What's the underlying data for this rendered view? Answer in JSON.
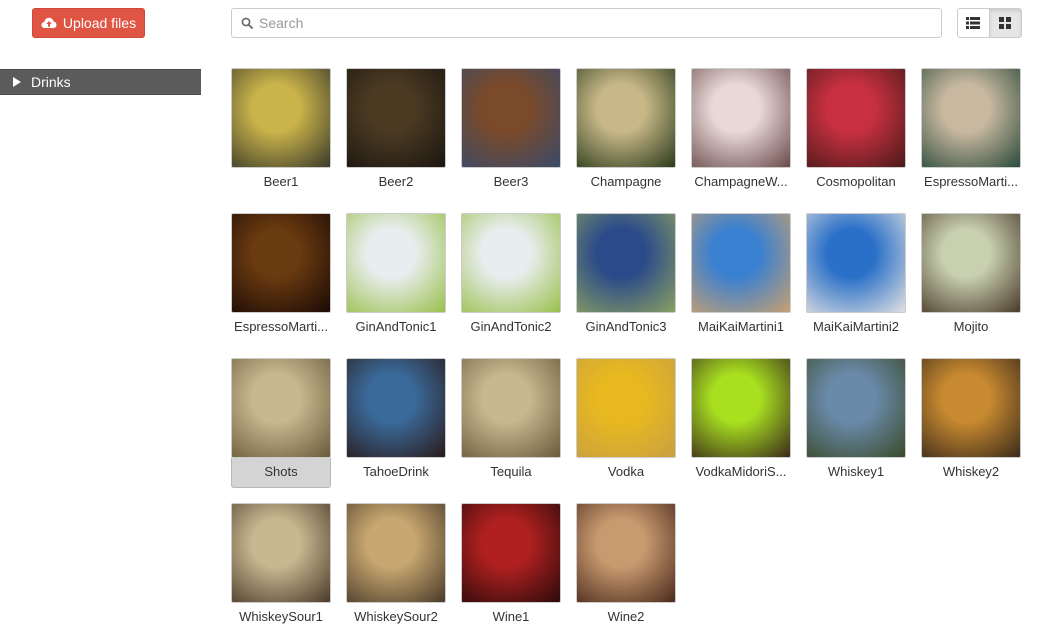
{
  "toolbar": {
    "upload_label": "Upload files",
    "search_placeholder": "Search",
    "search_value": "",
    "view_list_icon": "list-icon",
    "view_grid_icon": "grid-icon",
    "active_view": "grid"
  },
  "sidebar": {
    "items": [
      {
        "label": "Drinks",
        "icon": "triangle-right-icon",
        "expanded": false
      }
    ]
  },
  "colors": {
    "upload_bg": "#e05444",
    "sidebar_bg": "#5b5b5b",
    "selected_bg": "#d4d4d4"
  },
  "files": [
    {
      "label": "Beer1",
      "colors": [
        "#c9b34a",
        "#3a3a2a"
      ]
    },
    {
      "label": "Beer2",
      "colors": [
        "#4a3a22",
        "#1b1510"
      ]
    },
    {
      "label": "Beer3",
      "colors": [
        "#7a4a2a",
        "#3a4a6a"
      ]
    },
    {
      "label": "Champagne",
      "colors": [
        "#c8b888",
        "#2a3a1a"
      ]
    },
    {
      "label": "ChampagneW...",
      "colors": [
        "#e8d8d8",
        "#6a4a4a"
      ]
    },
    {
      "label": "Cosmopolitan",
      "colors": [
        "#c83040",
        "#4a1a1a"
      ]
    },
    {
      "label": "EspressoMarti...",
      "colors": [
        "#c8b8a0",
        "#2a4a3a"
      ]
    },
    {
      "label": "EspressoMarti...",
      "colors": [
        "#6a3a10",
        "#1a0a05"
      ]
    },
    {
      "label": "GinAndTonic1",
      "colors": [
        "#e8eef0",
        "#9abf4a"
      ]
    },
    {
      "label": "GinAndTonic2",
      "colors": [
        "#e8eef0",
        "#9abf4a"
      ]
    },
    {
      "label": "GinAndTonic3",
      "colors": [
        "#2a4a8a",
        "#8aa060"
      ]
    },
    {
      "label": "MaiKaiMartini1",
      "colors": [
        "#3a80d0",
        "#c8a070"
      ]
    },
    {
      "label": "MaiKaiMartini2",
      "colors": [
        "#2a70c8",
        "#e0e0e0"
      ]
    },
    {
      "label": "Mojito",
      "colors": [
        "#c8d0b0",
        "#4a3a2a"
      ]
    },
    {
      "label": "Shots",
      "colors": [
        "#c8b890",
        "#6a5a3a"
      ],
      "selected": true
    },
    {
      "label": "TahoeDrink",
      "colors": [
        "#3a6a9a",
        "#2a1a1a"
      ]
    },
    {
      "label": "Tequila",
      "colors": [
        "#c8b890",
        "#6a5a3a"
      ]
    },
    {
      "label": "Vodka",
      "colors": [
        "#e8b820",
        "#c8a040"
      ]
    },
    {
      "label": "VodkaMidoriS...",
      "colors": [
        "#a8e020",
        "#3a2a1a"
      ]
    },
    {
      "label": "Whiskey1",
      "colors": [
        "#6a8aaa",
        "#3a4a2a"
      ]
    },
    {
      "label": "Whiskey2",
      "colors": [
        "#c88a30",
        "#3a2a1a"
      ]
    },
    {
      "label": "WhiskeySour1",
      "colors": [
        "#c8b890",
        "#4a3a2a"
      ]
    },
    {
      "label": "WhiskeySour2",
      "colors": [
        "#c8a870",
        "#4a3a2a"
      ]
    },
    {
      "label": "Wine1",
      "colors": [
        "#b02020",
        "#2a0a0a"
      ]
    },
    {
      "label": "Wine2",
      "colors": [
        "#c89a70",
        "#4a2a1a"
      ]
    }
  ]
}
